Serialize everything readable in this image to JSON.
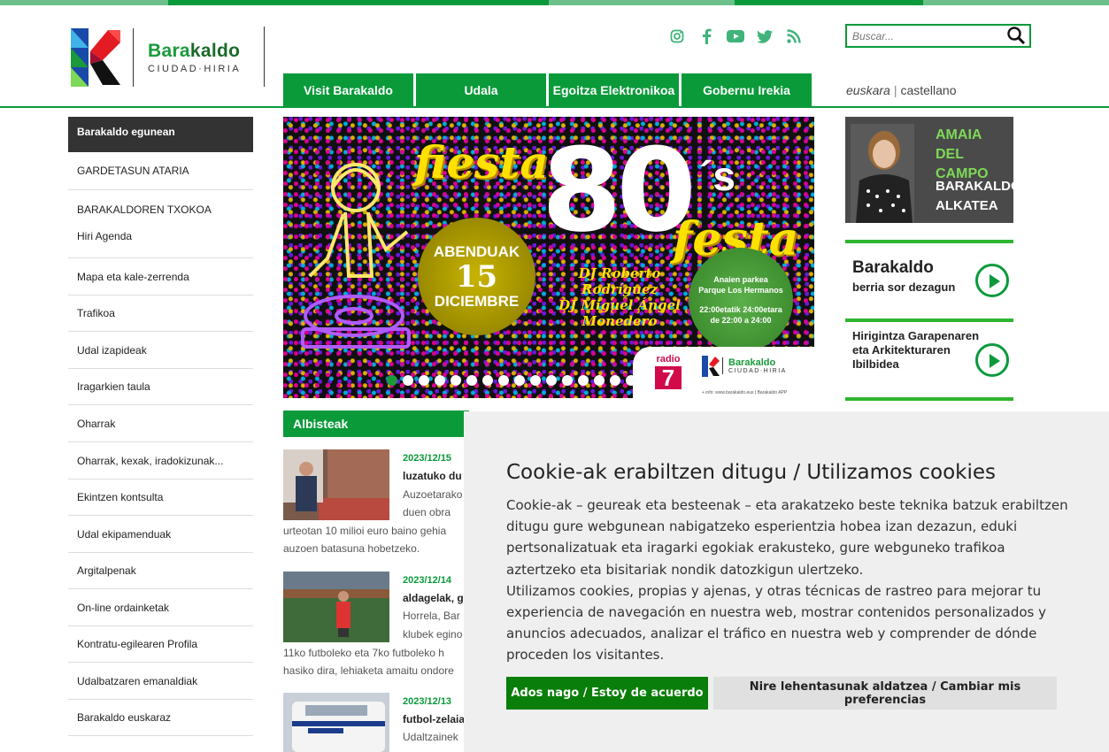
{
  "colors": {
    "brand_green": "#0a9a3a",
    "dark_green": "#1a6a2a",
    "stripe_light": "#6cc089",
    "sidebar_active": "#333333",
    "cookie_bg": "#efefef",
    "accept_button": "#0a7e0a"
  },
  "header": {
    "logo": {
      "name_part1": "Bara",
      "name_part2": "kaldo",
      "subtitle": "CIUDAD·HIRIA"
    },
    "social": [
      {
        "icon": "instagram-icon"
      },
      {
        "icon": "facebook-icon"
      },
      {
        "icon": "youtube-icon"
      },
      {
        "icon": "twitter-icon"
      },
      {
        "icon": "rss-icon"
      }
    ],
    "search": {
      "placeholder": "Buscar..."
    },
    "nav": [
      "Visit Barakaldo",
      "Udala",
      "Egoitza Elektronikoa",
      "Gobernu Irekia"
    ],
    "lang": {
      "eu": "euskara",
      "separator": "|",
      "es": "castellano"
    }
  },
  "sidebar": {
    "active": "Barakaldo egunean",
    "items": [
      "GARDETASUN ATARIA",
      "BARAKALDOREN TXOKOA",
      "Hiri Agenda",
      "Mapa eta kale-zerrenda",
      "Trafikoa",
      "Udal izapideak",
      "Iragarkien taula",
      "Oharrak",
      "Oharrak, kexak, iradokizunak...",
      "Ekintzen kontsulta",
      "Udal ekipamenduak",
      "Argitalpenak",
      "On-line ordainketak",
      "Kontratu-egilearen Profila",
      "Udalbatzaren emanaldiak",
      "Barakaldo euskaraz"
    ]
  },
  "slider": {
    "title1": "fiesta",
    "title2": "80",
    "title3": "´s",
    "title4": "festa",
    "date_month1": "ABENDUAK",
    "date_day": "15",
    "date_month2": "DICIEMBRE",
    "djs": [
      "DJ Roberto",
      "Rodríguez",
      "DJ Miguel Ángel",
      "Monedero"
    ],
    "place": [
      "Anaien parkea",
      "Parque Los Hermanos",
      "22:00etatik 24:00etara",
      "de 22:00 a 24:00"
    ],
    "radio_label": "radio",
    "radio_number": "7",
    "logo_name": "Barakaldo",
    "logo_sub": "CIUDAD·HIRIA",
    "info": "+ info: www.barakaldo.eus | Barakaldo APP",
    "dots_count": 16,
    "active_dot": 1
  },
  "news": {
    "heading": "Albisteak",
    "items": [
      {
        "date": "2023/12/15",
        "title": "luzatuko du",
        "lines": [
          "Auzoetarako",
          "duen obra",
          "urteotan 10 milioi euro baino gehia",
          "auzoen batasuna hobetzeko."
        ]
      },
      {
        "date": "2023/12/14",
        "title": "aldagelak, g",
        "lines": [
          "Horrela, Bar",
          "klubek egino",
          "11ko futboleko eta 7ko futboleko h",
          "hasiko dira, lehiaketa amaitu ondore"
        ]
      },
      {
        "date": "2023/12/13",
        "title": "futbol-zelaia",
        "lines": [
          "Udaltzainek"
        ]
      }
    ]
  },
  "right": {
    "mayor": {
      "name_line1": "AMAIA",
      "name_line2": "DEL CAMPO",
      "role_line1": "BARAKALDOKO",
      "role_line2": "ALKATEA"
    },
    "promo1": {
      "title": "Barakaldo",
      "subtitle": "berria sor dezagun"
    },
    "promo2": {
      "lines": [
        "Hirigintza Garapenaren",
        "eta Arkitekturaren",
        "Ibilbidea"
      ]
    }
  },
  "cookie": {
    "title": "Cookie-ak erabiltzen ditugu / Utilizamos cookies",
    "para_eu": "Cookie-ak – geureak eta besteenak – eta arakatzeko beste teknika batzuk erabiltzen ditugu gure webgunean nabigatzeko esperientzia hobea izan dezazun, eduki pertsonalizatuak eta iragarki egokiak erakusteko, gure webguneko trafikoa aztertzeko eta bisitariak nondik datozkigun ulertzeko.",
    "para_es": "Utilizamos cookies, propias y ajenas, y otras técnicas de rastreo para mejorar tu experiencia de navegación en nuestra web, mostrar contenidos personalizados y anuncios adecuados, analizar el tráfico en nuestra web y comprender de dónde proceden los visitantes.",
    "accept": "Ados nago / Estoy de acuerdo",
    "preferences": "Nire lehentasunak aldatzea / Cambiar mis preferencias"
  }
}
